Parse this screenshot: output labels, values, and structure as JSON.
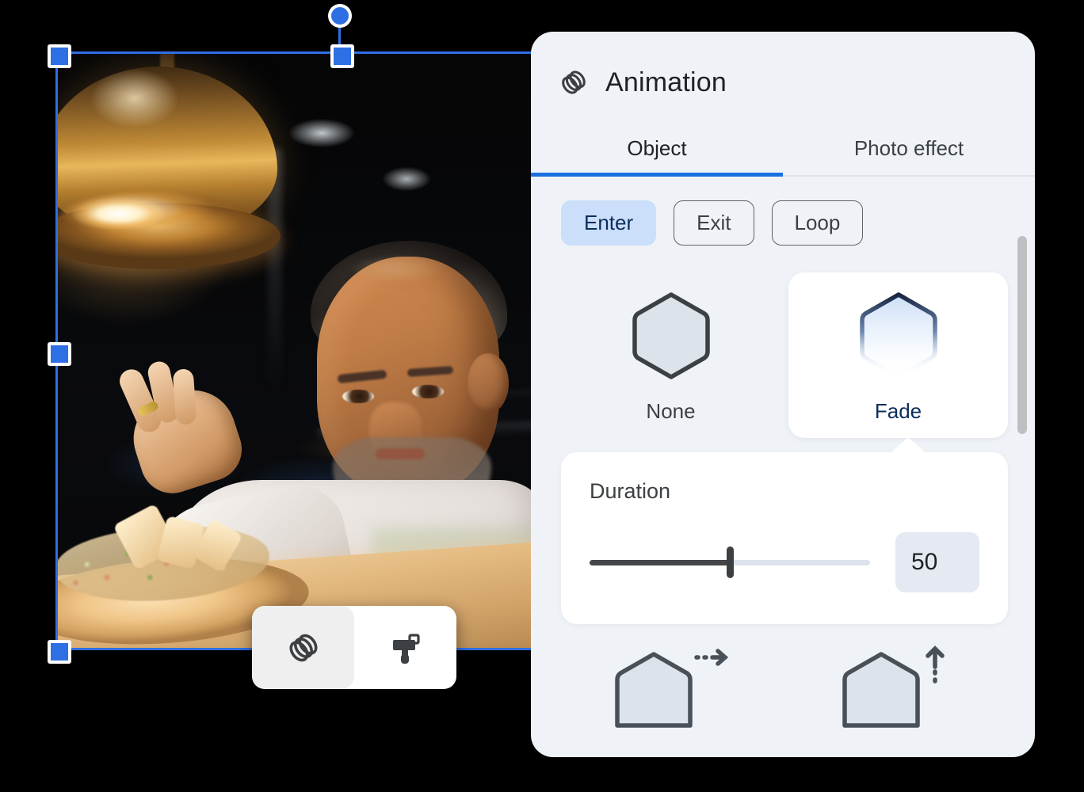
{
  "panel": {
    "title": "Animation",
    "title_icon": "animation-rings-icon",
    "tabs": [
      {
        "label": "Object",
        "active": true
      },
      {
        "label": "Photo effect",
        "active": false
      }
    ],
    "chips": [
      {
        "label": "Enter",
        "active": true
      },
      {
        "label": "Exit",
        "active": false
      },
      {
        "label": "Loop",
        "active": false
      }
    ],
    "animations": [
      {
        "label": "None",
        "icon": "hexagon-plain-icon",
        "selected": false
      },
      {
        "label": "Fade",
        "icon": "hexagon-fade-icon",
        "selected": true
      }
    ],
    "duration": {
      "label": "Duration",
      "value": "50",
      "percent": 50
    },
    "bottom_options": [
      {
        "icon": "hexagon-slide-right-icon",
        "label": ""
      },
      {
        "icon": "hexagon-rise-up-icon",
        "label": ""
      }
    ]
  },
  "floating_toolbar": {
    "buttons": [
      {
        "icon": "animation-rings-icon",
        "active": true
      },
      {
        "icon": "paint-roller-icon",
        "active": false
      }
    ]
  },
  "canvas": {
    "object_type": "image",
    "description": "Chef plating a dish under a copper heat lamp",
    "selected": true,
    "handles": [
      "top-left",
      "top-center",
      "middle-left",
      "bottom-left",
      "rotate"
    ]
  },
  "colors": {
    "accent": "#1a6fe0",
    "selection": "#2f6fe4",
    "chip_active_bg": "#ccdffa",
    "chip_active_text": "#0b2d5c",
    "panel_bg": "#eff3f8",
    "card_bg": "#ffffff",
    "value_box_bg": "#e4e9f2",
    "slider_fill": "#444548",
    "slider_track": "#dde3ed"
  }
}
